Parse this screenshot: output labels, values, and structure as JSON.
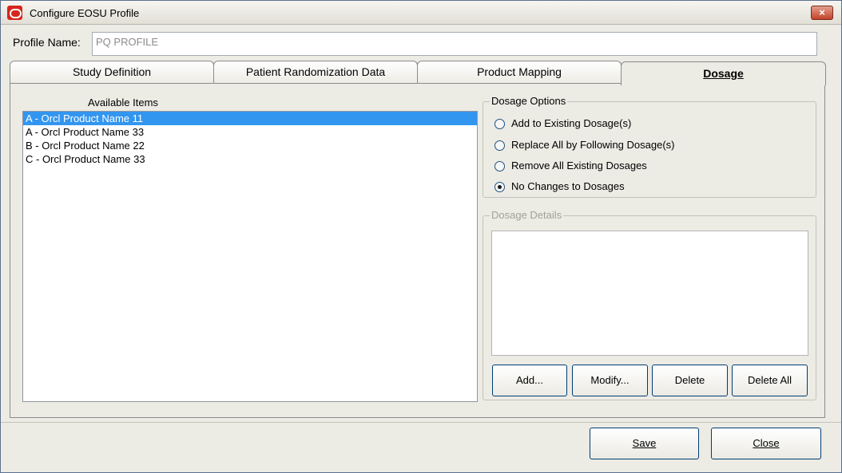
{
  "window": {
    "title": "Configure EOSU Profile",
    "close_glyph": "×"
  },
  "profile": {
    "label": "Profile Name:",
    "value": "PQ PROFILE"
  },
  "tabs": [
    {
      "label": "Study Definition",
      "active": false
    },
    {
      "label": "Patient Randomization Data",
      "active": false
    },
    {
      "label": "Product Mapping",
      "active": false
    },
    {
      "label": "Dosage",
      "active": true
    }
  ],
  "available_items": {
    "label": "Available Items",
    "items": [
      {
        "text": "A - Orcl Product Name 11",
        "selected": true
      },
      {
        "text": "A - Orcl Product Name 33",
        "selected": false
      },
      {
        "text": "B - Orcl Product Name 22",
        "selected": false
      },
      {
        "text": "C - Orcl Product Name 33",
        "selected": false
      }
    ]
  },
  "dosage_options": {
    "title": "Dosage Options",
    "options": [
      {
        "label": "Add to Existing Dosage(s)",
        "checked": false
      },
      {
        "label": "Replace All by Following Dosage(s)",
        "checked": false
      },
      {
        "label": "Remove All Existing Dosages",
        "checked": false
      },
      {
        "label": "No Changes to Dosages",
        "checked": true
      }
    ]
  },
  "dosage_details": {
    "title": "Dosage Details",
    "buttons": {
      "add": "Add...",
      "modify": "Modify...",
      "delete": "Delete",
      "delete_all": "Delete All"
    }
  },
  "footer": {
    "save": "Save",
    "close": "Close"
  },
  "colors": {
    "selection": "#3296f0",
    "window_bg": "#ecebe4",
    "close_button": "#c4432b",
    "app_icon": "#d6251c"
  },
  "icons": {
    "app": "oracle-logo-icon",
    "close": "close-icon"
  }
}
